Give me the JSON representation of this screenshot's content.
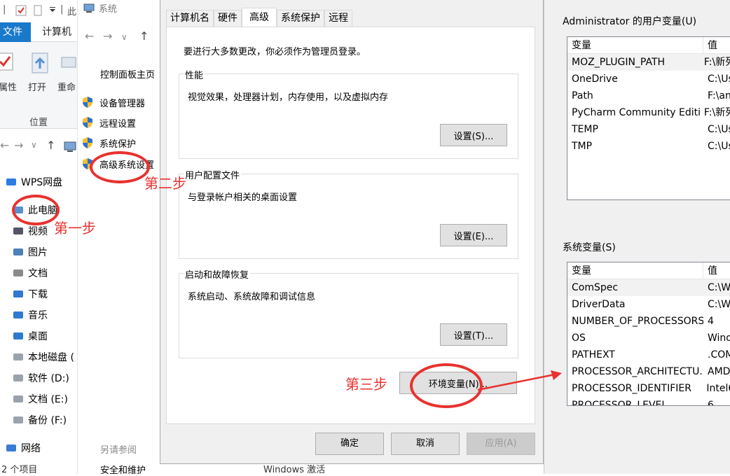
{
  "explorer": {
    "qat_sep": "|",
    "qat_text": "此",
    "tabs": {
      "file": "文件",
      "computer": "计算机"
    },
    "ribbon": {
      "properties": "属性",
      "open": "打开",
      "rename": "重命",
      "group_label": "位置"
    },
    "nav": [
      {
        "label": "WPS网盘",
        "icon": "cloud-icon"
      },
      {
        "label": "此电脑",
        "icon": "computer-icon"
      },
      {
        "label": "视频",
        "icon": "video-folder-icon"
      },
      {
        "label": "图片",
        "icon": "picture-folder-icon"
      },
      {
        "label": "文档",
        "icon": "document-folder-icon"
      },
      {
        "label": "下载",
        "icon": "download-folder-icon"
      },
      {
        "label": "音乐",
        "icon": "music-folder-icon"
      },
      {
        "label": "桌面",
        "icon": "desktop-folder-icon"
      },
      {
        "label": "本地磁盘 (",
        "icon": "drive-icon"
      },
      {
        "label": "软件 (D:)",
        "icon": "drive-icon"
      },
      {
        "label": "文档 (E:)",
        "icon": "drive-icon"
      },
      {
        "label": "备份 (F:)",
        "icon": "drive-icon"
      },
      {
        "label": "网络",
        "icon": "network-icon"
      }
    ],
    "status": "2 个项目"
  },
  "system_panel": {
    "title": "系统",
    "home": "控制面板主页",
    "links": [
      "设备管理器",
      "远程设置",
      "系统保护",
      "高级系统设置"
    ],
    "see_also": "另请参阅",
    "security": "安全和维护",
    "watermark": "Windows 激活"
  },
  "dialog": {
    "tabs": [
      "计算机名",
      "硬件",
      "高级",
      "系统保护",
      "远程"
    ],
    "active_tab": "高级",
    "notice": "要进行大多数更改，你必须作为管理员登录。",
    "groups": [
      {
        "title": "性能",
        "desc": "视觉效果，处理器计划，内存使用，以及虚拟内存",
        "button": "设置(S)..."
      },
      {
        "title": "用户配置文件",
        "desc": "与登录帐户相关的桌面设置",
        "button": "设置(E)..."
      },
      {
        "title": "启动和故障恢复",
        "desc": "系统启动、系统故障和调试信息",
        "button": "设置(T)..."
      }
    ],
    "env_button": "环境变量(N)...",
    "ok": "确定",
    "cancel": "取消",
    "apply": "应用(A)"
  },
  "env_vars": {
    "user_label": "Administrator 的用户变量(U)",
    "system_label": "系统变量(S)",
    "col_var": "变量",
    "col_val": "值",
    "user_rows": [
      {
        "name": "MOZ_PLUGIN_PATH",
        "value": "F:\\新列"
      },
      {
        "name": "OneDrive",
        "value": "C:\\Us"
      },
      {
        "name": "Path",
        "value": "F:\\an"
      },
      {
        "name": "PyCharm Community Editi...",
        "value": "F:\\新列"
      },
      {
        "name": "TEMP",
        "value": "C:\\Us"
      },
      {
        "name": "TMP",
        "value": "C:\\Us"
      }
    ],
    "system_rows": [
      {
        "name": "ComSpec",
        "value": "C:\\Wi"
      },
      {
        "name": "DriverData",
        "value": "C:\\Wi"
      },
      {
        "name": "NUMBER_OF_PROCESSORS",
        "value": "4"
      },
      {
        "name": "OS",
        "value": "Wind"
      },
      {
        "name": "PATHEXT",
        "value": ".COM"
      },
      {
        "name": "PROCESSOR_ARCHITECTU...",
        "value": "AMD"
      },
      {
        "name": "PROCESSOR_IDENTIFIER",
        "value": "Intel6"
      },
      {
        "name": "PROCESSOR_LEVEL",
        "value": "6"
      }
    ]
  },
  "annotations": {
    "step1": "第一步",
    "step2": "第二步",
    "step3": "第三步"
  },
  "colors": {
    "accent": "#1979ca",
    "annotation": "#e8322f"
  }
}
